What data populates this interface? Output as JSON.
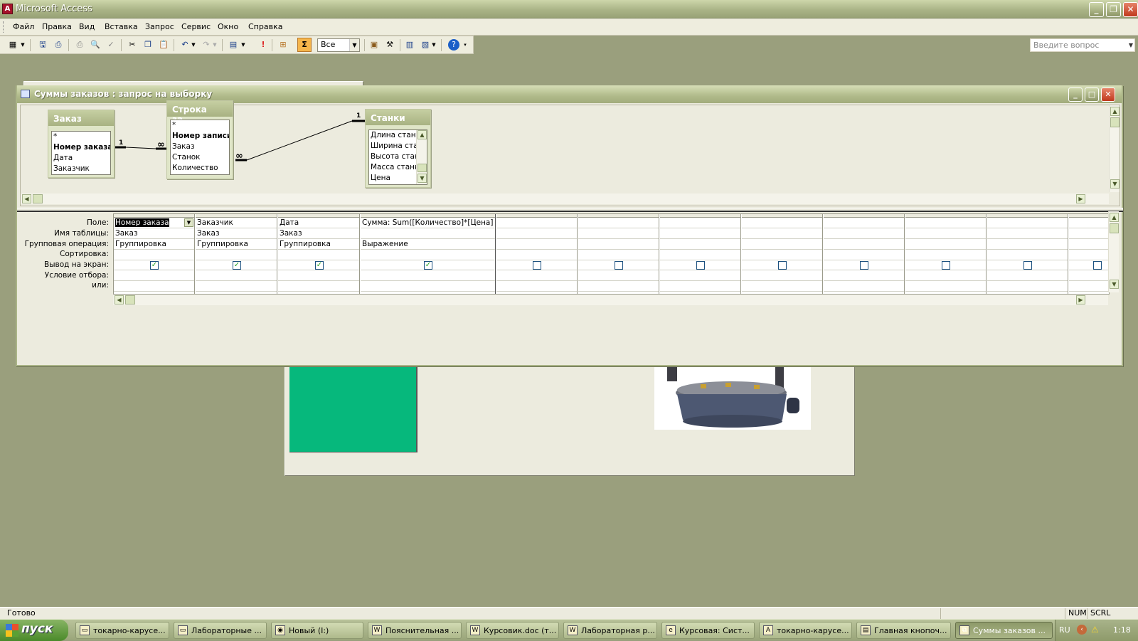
{
  "app": {
    "title": "Microsoft Access",
    "icon": "access-icon"
  },
  "menu": {
    "items": [
      "Файл",
      "Правка",
      "Вид",
      "Вставка",
      "Запрос",
      "Сервис",
      "Окно",
      "Справка"
    ],
    "help_placeholder": "Введите вопрос"
  },
  "toolbar": {
    "top_values": "Все",
    "sigma": "Σ"
  },
  "query_window": {
    "title": "Суммы заказов : запрос на выборку",
    "tables": [
      {
        "name": "Заказ",
        "fields": [
          "*",
          "Номер заказа",
          "Дата",
          "Заказчик"
        ],
        "key": "Номер заказа"
      },
      {
        "name": "Строка за...",
        "fields": [
          "*",
          "Номер записи",
          "Заказ",
          "Станок",
          "Количество"
        ],
        "key": "Номер записи"
      },
      {
        "name": "Станки",
        "fields": [
          "Длина станка",
          "Ширина стан",
          "Высота стан",
          "Масса станка",
          "Цена"
        ]
      }
    ],
    "relations": [
      {
        "one": "1",
        "many": "∞"
      },
      {
        "one": "1",
        "many": "∞"
      }
    ],
    "row_labels": [
      "Поле:",
      "Имя таблицы:",
      "Групповая операция:",
      "Сортировка:",
      "Вывод на экран:",
      "Условие отбора:",
      "или:"
    ],
    "columns": [
      {
        "field": "Номер заказа",
        "table": "Заказ",
        "group": "Группировка",
        "sort": "",
        "show": true
      },
      {
        "field": "Заказчик",
        "table": "Заказ",
        "group": "Группировка",
        "sort": "",
        "show": true
      },
      {
        "field": "Дата",
        "table": "Заказ",
        "group": "Группировка",
        "sort": "",
        "show": true
      },
      {
        "field": "Сумма: Sum([Количество]*[Цена]",
        "table": "",
        "group": "Выражение",
        "sort": "",
        "show": true
      },
      {
        "field": "",
        "table": "",
        "group": "",
        "sort": "",
        "show": false
      },
      {
        "field": "",
        "table": "",
        "group": "",
        "sort": "",
        "show": false
      },
      {
        "field": "",
        "table": "",
        "group": "",
        "sort": "",
        "show": false
      },
      {
        "field": "",
        "table": "",
        "group": "",
        "sort": "",
        "show": false
      },
      {
        "field": "",
        "table": "",
        "group": "",
        "sort": "",
        "show": false
      },
      {
        "field": "",
        "table": "",
        "group": "",
        "sort": "",
        "show": false
      },
      {
        "field": "",
        "table": "",
        "group": "",
        "sort": "",
        "show": false
      },
      {
        "field": "",
        "table": "",
        "group": "",
        "sort": "",
        "show": false
      }
    ]
  },
  "status": {
    "text": "Готово",
    "num": "NUM",
    "scrl": "SCRL"
  },
  "taskbar": {
    "start": "пуск",
    "buttons": [
      {
        "label": "токарно-карусе...",
        "icon": "folder-icon",
        "active": false
      },
      {
        "label": "Лабораторные ...",
        "icon": "folder-icon",
        "active": false
      },
      {
        "label": "Новый (I:)",
        "icon": "drive-icon",
        "active": false
      },
      {
        "label": "Пояснительная ...",
        "icon": "word-icon",
        "active": false
      },
      {
        "label": "Курсовик.doc (т...",
        "icon": "word-icon",
        "active": false
      },
      {
        "label": "Лабораторная р...",
        "icon": "word-icon",
        "active": false
      },
      {
        "label": "Курсовая: Сист...",
        "icon": "ie-icon",
        "active": false
      },
      {
        "label": "токарно-карусе...",
        "icon": "access-icon",
        "active": false
      },
      {
        "label": "Главная кнопоч...",
        "icon": "form-icon",
        "active": false
      },
      {
        "label": "Суммы заказов ...",
        "icon": "query-icon",
        "active": true
      }
    ],
    "lang": "RU",
    "clock": "1:18"
  }
}
